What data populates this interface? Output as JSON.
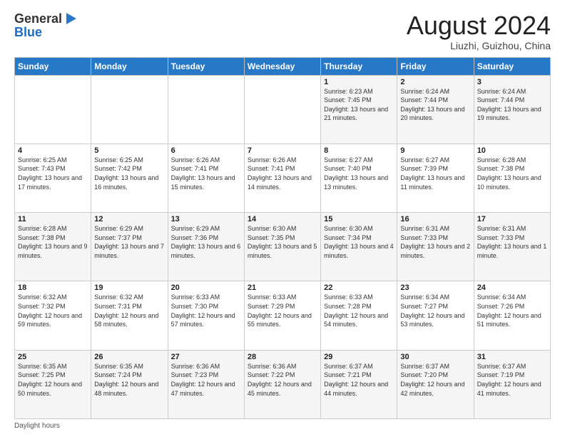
{
  "logo": {
    "general": "General",
    "blue": "Blue"
  },
  "title": "August 2024",
  "location": "Liuzhi, Guizhou, China",
  "days_of_week": [
    "Sunday",
    "Monday",
    "Tuesday",
    "Wednesday",
    "Thursday",
    "Friday",
    "Saturday"
  ],
  "footer": "Daylight hours",
  "weeks": [
    [
      {
        "day": "",
        "info": ""
      },
      {
        "day": "",
        "info": ""
      },
      {
        "day": "",
        "info": ""
      },
      {
        "day": "",
        "info": ""
      },
      {
        "day": "1",
        "info": "Sunrise: 6:23 AM\nSunset: 7:45 PM\nDaylight: 13 hours and 21 minutes."
      },
      {
        "day": "2",
        "info": "Sunrise: 6:24 AM\nSunset: 7:44 PM\nDaylight: 13 hours and 20 minutes."
      },
      {
        "day": "3",
        "info": "Sunrise: 6:24 AM\nSunset: 7:44 PM\nDaylight: 13 hours and 19 minutes."
      }
    ],
    [
      {
        "day": "4",
        "info": "Sunrise: 6:25 AM\nSunset: 7:43 PM\nDaylight: 13 hours and 17 minutes."
      },
      {
        "day": "5",
        "info": "Sunrise: 6:25 AM\nSunset: 7:42 PM\nDaylight: 13 hours and 16 minutes."
      },
      {
        "day": "6",
        "info": "Sunrise: 6:26 AM\nSunset: 7:41 PM\nDaylight: 13 hours and 15 minutes."
      },
      {
        "day": "7",
        "info": "Sunrise: 6:26 AM\nSunset: 7:41 PM\nDaylight: 13 hours and 14 minutes."
      },
      {
        "day": "8",
        "info": "Sunrise: 6:27 AM\nSunset: 7:40 PM\nDaylight: 13 hours and 13 minutes."
      },
      {
        "day": "9",
        "info": "Sunrise: 6:27 AM\nSunset: 7:39 PM\nDaylight: 13 hours and 11 minutes."
      },
      {
        "day": "10",
        "info": "Sunrise: 6:28 AM\nSunset: 7:38 PM\nDaylight: 13 hours and 10 minutes."
      }
    ],
    [
      {
        "day": "11",
        "info": "Sunrise: 6:28 AM\nSunset: 7:38 PM\nDaylight: 13 hours and 9 minutes."
      },
      {
        "day": "12",
        "info": "Sunrise: 6:29 AM\nSunset: 7:37 PM\nDaylight: 13 hours and 7 minutes."
      },
      {
        "day": "13",
        "info": "Sunrise: 6:29 AM\nSunset: 7:36 PM\nDaylight: 13 hours and 6 minutes."
      },
      {
        "day": "14",
        "info": "Sunrise: 6:30 AM\nSunset: 7:35 PM\nDaylight: 13 hours and 5 minutes."
      },
      {
        "day": "15",
        "info": "Sunrise: 6:30 AM\nSunset: 7:34 PM\nDaylight: 13 hours and 4 minutes."
      },
      {
        "day": "16",
        "info": "Sunrise: 6:31 AM\nSunset: 7:33 PM\nDaylight: 13 hours and 2 minutes."
      },
      {
        "day": "17",
        "info": "Sunrise: 6:31 AM\nSunset: 7:33 PM\nDaylight: 13 hours and 1 minute."
      }
    ],
    [
      {
        "day": "18",
        "info": "Sunrise: 6:32 AM\nSunset: 7:32 PM\nDaylight: 12 hours and 59 minutes."
      },
      {
        "day": "19",
        "info": "Sunrise: 6:32 AM\nSunset: 7:31 PM\nDaylight: 12 hours and 58 minutes."
      },
      {
        "day": "20",
        "info": "Sunrise: 6:33 AM\nSunset: 7:30 PM\nDaylight: 12 hours and 57 minutes."
      },
      {
        "day": "21",
        "info": "Sunrise: 6:33 AM\nSunset: 7:29 PM\nDaylight: 12 hours and 55 minutes."
      },
      {
        "day": "22",
        "info": "Sunrise: 6:33 AM\nSunset: 7:28 PM\nDaylight: 12 hours and 54 minutes."
      },
      {
        "day": "23",
        "info": "Sunrise: 6:34 AM\nSunset: 7:27 PM\nDaylight: 12 hours and 53 minutes."
      },
      {
        "day": "24",
        "info": "Sunrise: 6:34 AM\nSunset: 7:26 PM\nDaylight: 12 hours and 51 minutes."
      }
    ],
    [
      {
        "day": "25",
        "info": "Sunrise: 6:35 AM\nSunset: 7:25 PM\nDaylight: 12 hours and 50 minutes."
      },
      {
        "day": "26",
        "info": "Sunrise: 6:35 AM\nSunset: 7:24 PM\nDaylight: 12 hours and 48 minutes."
      },
      {
        "day": "27",
        "info": "Sunrise: 6:36 AM\nSunset: 7:23 PM\nDaylight: 12 hours and 47 minutes."
      },
      {
        "day": "28",
        "info": "Sunrise: 6:36 AM\nSunset: 7:22 PM\nDaylight: 12 hours and 45 minutes."
      },
      {
        "day": "29",
        "info": "Sunrise: 6:37 AM\nSunset: 7:21 PM\nDaylight: 12 hours and 44 minutes."
      },
      {
        "day": "30",
        "info": "Sunrise: 6:37 AM\nSunset: 7:20 PM\nDaylight: 12 hours and 42 minutes."
      },
      {
        "day": "31",
        "info": "Sunrise: 6:37 AM\nSunset: 7:19 PM\nDaylight: 12 hours and 41 minutes."
      }
    ]
  ]
}
